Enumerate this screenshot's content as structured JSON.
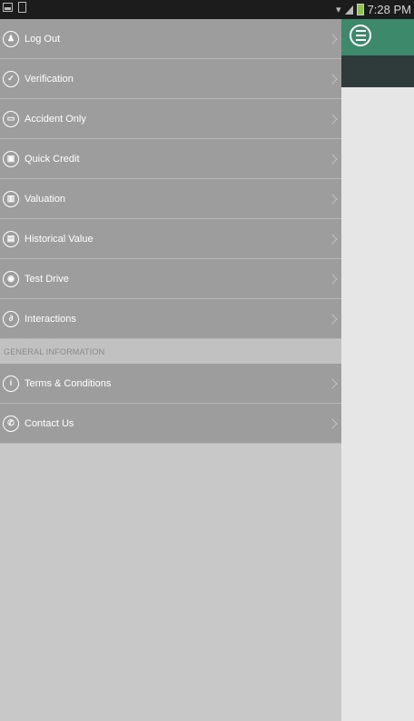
{
  "status_bar": {
    "time": "7:28 PM",
    "battery_color": "#8ec63f"
  },
  "app_bar": {
    "accent": "#3c8a6b",
    "menu_icon": "hamburger-menu-icon"
  },
  "drawer": {
    "items": [
      {
        "label": "Log Out",
        "icon": "user-icon",
        "glyph": "♟"
      },
      {
        "label": "Verification",
        "icon": "thumbs-up-icon",
        "glyph": "👍"
      },
      {
        "label": "Accident Only",
        "icon": "car-icon",
        "glyph": "▭"
      },
      {
        "label": "Quick Credit",
        "icon": "credit-icon",
        "glyph": "▣"
      },
      {
        "label": "Valuation",
        "icon": "bar-chart-icon",
        "glyph": "▥"
      },
      {
        "label": "Historical Value",
        "icon": "history-icon",
        "glyph": "▤"
      },
      {
        "label": "Test Drive",
        "icon": "steering-wheel-icon",
        "glyph": "◉"
      },
      {
        "label": "Interactions",
        "icon": "link-icon",
        "glyph": "∂"
      }
    ],
    "section_header": "GENERAL INFORMATION",
    "info_items": [
      {
        "label": "Terms & Conditions",
        "icon": "info-icon",
        "glyph": "i"
      },
      {
        "label": "Contact Us",
        "icon": "phone-icon",
        "glyph": "✆"
      }
    ]
  }
}
